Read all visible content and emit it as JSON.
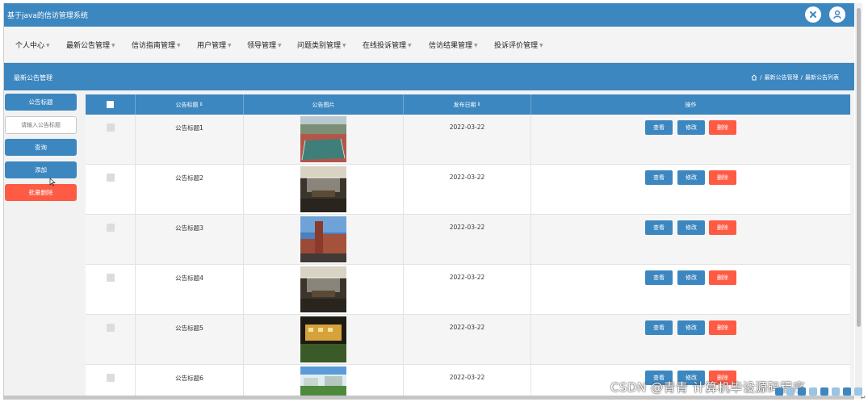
{
  "app": {
    "title": "基于java的信访管理系统"
  },
  "topbar_icons": [
    "close-circle-icon",
    "user-avatar-icon"
  ],
  "menu": [
    {
      "label": "个人中心",
      "caret": "▼"
    },
    {
      "label": "最新公告管理",
      "caret": "▼"
    },
    {
      "label": "信访指南管理",
      "caret": "▼"
    },
    {
      "label": "用户管理",
      "caret": "▼"
    },
    {
      "label": "领导管理",
      "caret": "▼"
    },
    {
      "label": "问题类别管理",
      "caret": "▼"
    },
    {
      "label": "在线投诉管理",
      "caret": "▼"
    },
    {
      "label": "信访结果管理",
      "caret": "▼"
    },
    {
      "label": "投诉评价管理",
      "caret": "▼"
    }
  ],
  "subheader": {
    "title": "最新公告管理",
    "breadcrumb": [
      "最新公告管理",
      "最新公告列表"
    ],
    "separator": "/"
  },
  "sidebar": {
    "field_label": "公告标题",
    "search_placeholder": "请输入公告标题",
    "search_button": "查询",
    "add_button": "添加",
    "batch_delete_button": "批量删除"
  },
  "table": {
    "headers": {
      "title": "公告标题",
      "image": "公告图片",
      "date": "发布日期",
      "actions": "操作",
      "sort_mark": "⇕"
    },
    "action_labels": {
      "view": "查看",
      "edit": "修改",
      "delete": "删除"
    },
    "rows": [
      {
        "title": "公告标题1",
        "date": "2022-03-22",
        "image": "court-photo"
      },
      {
        "title": "公告标题2",
        "date": "2022-03-22",
        "image": "meeting-room-photo"
      },
      {
        "title": "公告标题3",
        "date": "2022-03-22",
        "image": "building-photo"
      },
      {
        "title": "公告标题4",
        "date": "2022-03-22",
        "image": "meeting-room-photo"
      },
      {
        "title": "公告标题5",
        "date": "2022-03-22",
        "image": "night-building-photo"
      },
      {
        "title": "公告标题6",
        "date": "2022-03-22",
        "image": "campus-photo"
      }
    ]
  },
  "watermark": "CSDN @青青  计算机毕设源码程序",
  "colors": {
    "primary": "#3c87c0",
    "danger": "#ff5a43"
  }
}
